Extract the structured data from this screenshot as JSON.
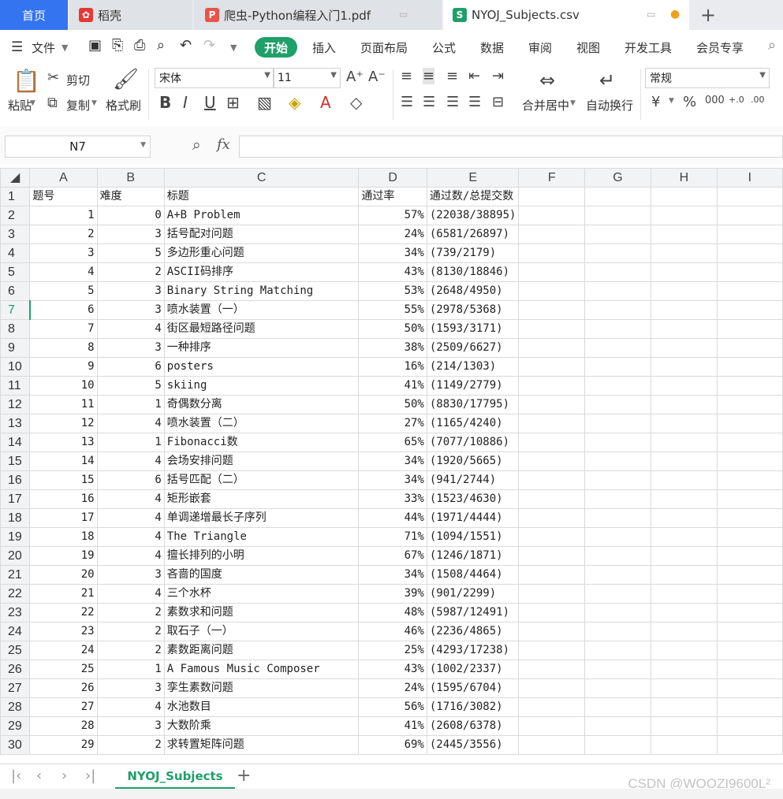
{
  "tabs": {
    "home": "首页",
    "daoke": "稻壳",
    "pdf": "爬虫-Python编程入门1.pdf",
    "csv": "NYOJ_Subjects.csv"
  },
  "menu": {
    "file": "文件",
    "start": "开始",
    "insert": "插入",
    "layout": "页面布局",
    "formula": "公式",
    "data": "数据",
    "review": "审阅",
    "view": "视图",
    "dev": "开发工具",
    "vip": "会员专享"
  },
  "ribbon": {
    "paste": "粘贴",
    "cut": "剪切",
    "copy": "复制",
    "format_painter": "格式刷",
    "font_name": "宋体",
    "font_size": "11",
    "merge": "合并居中",
    "wrap": "自动换行",
    "number_format": "常规"
  },
  "formula_bar": {
    "cell_ref": "N7",
    "fx": "fx",
    "content": ""
  },
  "columns": [
    "A",
    "B",
    "C",
    "D",
    "E",
    "F",
    "G",
    "H",
    "I"
  ],
  "rows": [
    {
      "n": "1",
      "a": "题号",
      "b": "难度",
      "c": "标题",
      "d": "通过率",
      "e": "通过数/总提交数",
      "header": true
    },
    {
      "n": "2",
      "a": "1",
      "b": "0",
      "c": "A+B Problem",
      "d": "57%",
      "e": "(22038/38895)"
    },
    {
      "n": "3",
      "a": "2",
      "b": "3",
      "c": "括号配对问题",
      "d": "24%",
      "e": "(6581/26897)"
    },
    {
      "n": "4",
      "a": "3",
      "b": "5",
      "c": "多边形重心问题",
      "d": "34%",
      "e": "(739/2179)"
    },
    {
      "n": "5",
      "a": "4",
      "b": "2",
      "c": "ASCII码排序",
      "d": "43%",
      "e": "(8130/18846)"
    },
    {
      "n": "6",
      "a": "5",
      "b": "3",
      "c": "Binary String Matching",
      "d": "53%",
      "e": "(2648/4950)"
    },
    {
      "n": "7",
      "a": "6",
      "b": "3",
      "c": "喷水装置（一）",
      "d": "55%",
      "e": "(2978/5368)"
    },
    {
      "n": "8",
      "a": "7",
      "b": "4",
      "c": "街区最短路径问题",
      "d": "50%",
      "e": "(1593/3171)"
    },
    {
      "n": "9",
      "a": "8",
      "b": "3",
      "c": "一种排序",
      "d": "38%",
      "e": "(2509/6627)"
    },
    {
      "n": "10",
      "a": "9",
      "b": "6",
      "c": "posters",
      "d": "16%",
      "e": "(214/1303)"
    },
    {
      "n": "11",
      "a": "10",
      "b": "5",
      "c": "skiing",
      "d": "41%",
      "e": "(1149/2779)"
    },
    {
      "n": "12",
      "a": "11",
      "b": "1",
      "c": "奇偶数分离",
      "d": "50%",
      "e": "(8830/17795)"
    },
    {
      "n": "13",
      "a": "12",
      "b": "4",
      "c": "喷水装置（二）",
      "d": "27%",
      "e": "(1165/4240)"
    },
    {
      "n": "14",
      "a": "13",
      "b": "1",
      "c": "Fibonacci数",
      "d": "65%",
      "e": "(7077/10886)"
    },
    {
      "n": "15",
      "a": "14",
      "b": "4",
      "c": "会场安排问题",
      "d": "34%",
      "e": "(1920/5665)"
    },
    {
      "n": "16",
      "a": "15",
      "b": "6",
      "c": "括号匹配（二）",
      "d": "34%",
      "e": "(941/2744)"
    },
    {
      "n": "17",
      "a": "16",
      "b": "4",
      "c": "矩形嵌套",
      "d": "33%",
      "e": "(1523/4630)"
    },
    {
      "n": "18",
      "a": "17",
      "b": "4",
      "c": "单调递增最长子序列",
      "d": "44%",
      "e": "(1971/4444)"
    },
    {
      "n": "19",
      "a": "18",
      "b": "4",
      "c": "The Triangle",
      "d": "71%",
      "e": "(1094/1551)"
    },
    {
      "n": "20",
      "a": "19",
      "b": "4",
      "c": "擅长排列的小明",
      "d": "67%",
      "e": "(1246/1871)"
    },
    {
      "n": "21",
      "a": "20",
      "b": "3",
      "c": "吝啬的国度",
      "d": "34%",
      "e": "(1508/4464)"
    },
    {
      "n": "22",
      "a": "21",
      "b": "4",
      "c": "三个水杯",
      "d": "39%",
      "e": "(901/2299)"
    },
    {
      "n": "23",
      "a": "22",
      "b": "2",
      "c": "素数求和问题",
      "d": "48%",
      "e": "(5987/12491)"
    },
    {
      "n": "24",
      "a": "23",
      "b": "2",
      "c": "取石子（一）",
      "d": "46%",
      "e": "(2236/4865)"
    },
    {
      "n": "25",
      "a": "24",
      "b": "2",
      "c": "素数距离问题",
      "d": "25%",
      "e": "(4293/17238)"
    },
    {
      "n": "26",
      "a": "25",
      "b": "1",
      "c": "A Famous Music Composer",
      "d": "43%",
      "e": "(1002/2337)"
    },
    {
      "n": "27",
      "a": "26",
      "b": "3",
      "c": "孪生素数问题",
      "d": "24%",
      "e": "(1595/6704)"
    },
    {
      "n": "28",
      "a": "27",
      "b": "4",
      "c": "水池数目",
      "d": "56%",
      "e": "(1716/3082)"
    },
    {
      "n": "29",
      "a": "28",
      "b": "3",
      "c": "大数阶乘",
      "d": "41%",
      "e": "(2608/6378)"
    },
    {
      "n": "30",
      "a": "29",
      "b": "2",
      "c": "求转置矩阵问题",
      "d": "69%",
      "e": "(2445/3556)"
    }
  ],
  "sheet": {
    "name": "NYOJ_Subjects"
  },
  "watermark": "CSDN @WOOZI9600L²",
  "colors": {
    "accent": "#1fa06a",
    "home_tab": "#3574f0"
  }
}
